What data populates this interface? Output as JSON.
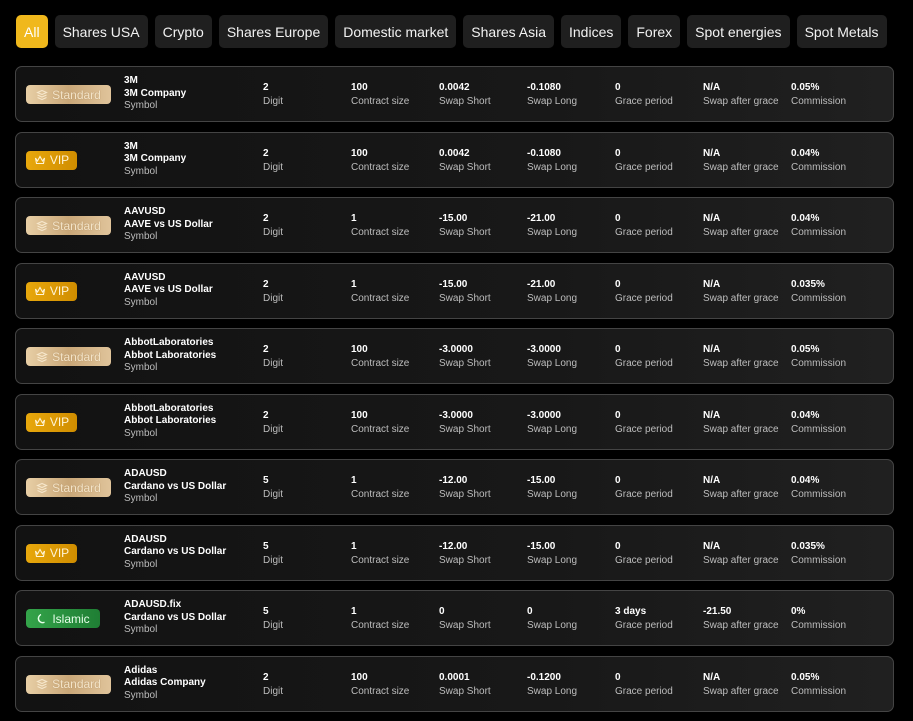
{
  "tabs": [
    "All",
    "Shares USA",
    "Crypto",
    "Shares Europe",
    "Domestic market",
    "Shares Asia",
    "Indices",
    "Forex",
    "Spot energies",
    "Spot Metals"
  ],
  "active_tab": "All",
  "labels": {
    "symbol": "Symbol",
    "digit": "Digit",
    "contract_size": "Contract size",
    "swap_short": "Swap Short",
    "swap_long": "Swap Long",
    "grace_period": "Grace period",
    "swap_after_grace": "Swap after grace",
    "commission": "Commission"
  },
  "colors": {
    "active_tab": "#f0b81c",
    "standard": "#d9bc8c",
    "vip": "#e09a05",
    "islamic": "#2a9140"
  },
  "rows": [
    {
      "account": "Standard",
      "icon": "layers-icon",
      "symbol": "3M",
      "name": "3M Company",
      "digit": "2",
      "contract_size": "100",
      "swap_short": "0.0042",
      "swap_long": "-0.1080",
      "grace_period": "0",
      "swap_after_grace": "N/A",
      "commission": "0.05%"
    },
    {
      "account": "VIP",
      "icon": "crown-icon",
      "symbol": "3M",
      "name": "3M Company",
      "digit": "2",
      "contract_size": "100",
      "swap_short": "0.0042",
      "swap_long": "-0.1080",
      "grace_period": "0",
      "swap_after_grace": "N/A",
      "commission": "0.04%"
    },
    {
      "account": "Standard",
      "icon": "layers-icon",
      "symbol": "AAVUSD",
      "name": "AAVE vs US Dollar",
      "digit": "2",
      "contract_size": "1",
      "swap_short": "-15.00",
      "swap_long": "-21.00",
      "grace_period": "0",
      "swap_after_grace": "N/A",
      "commission": "0.04%"
    },
    {
      "account": "VIP",
      "icon": "crown-icon",
      "symbol": "AAVUSD",
      "name": "AAVE vs US Dollar",
      "digit": "2",
      "contract_size": "1",
      "swap_short": "-15.00",
      "swap_long": "-21.00",
      "grace_period": "0",
      "swap_after_grace": "N/A",
      "commission": "0.035%"
    },
    {
      "account": "Standard",
      "icon": "layers-icon",
      "symbol": "AbbotLaboratories",
      "name": "Abbot Laboratories",
      "digit": "2",
      "contract_size": "100",
      "swap_short": "-3.0000",
      "swap_long": "-3.0000",
      "grace_period": "0",
      "swap_after_grace": "N/A",
      "commission": "0.05%"
    },
    {
      "account": "VIP",
      "icon": "crown-icon",
      "symbol": "AbbotLaboratories",
      "name": "Abbot Laboratories",
      "digit": "2",
      "contract_size": "100",
      "swap_short": "-3.0000",
      "swap_long": "-3.0000",
      "grace_period": "0",
      "swap_after_grace": "N/A",
      "commission": "0.04%"
    },
    {
      "account": "Standard",
      "icon": "layers-icon",
      "symbol": "ADAUSD",
      "name": "Cardano vs US Dollar",
      "digit": "5",
      "contract_size": "1",
      "swap_short": "-12.00",
      "swap_long": "-15.00",
      "grace_period": "0",
      "swap_after_grace": "N/A",
      "commission": "0.04%"
    },
    {
      "account": "VIP",
      "icon": "crown-icon",
      "symbol": "ADAUSD",
      "name": "Cardano vs US Dollar",
      "digit": "5",
      "contract_size": "1",
      "swap_short": "-12.00",
      "swap_long": "-15.00",
      "grace_period": "0",
      "swap_after_grace": "N/A",
      "commission": "0.035%"
    },
    {
      "account": "Islamic",
      "icon": "crescent-moon-icon",
      "symbol": "ADAUSD.fix",
      "name": "Cardano vs US Dollar",
      "digit": "5",
      "contract_size": "1",
      "swap_short": "0",
      "swap_long": "0",
      "grace_period": "3 days",
      "swap_after_grace": "-21.50",
      "commission": "0%"
    },
    {
      "account": "Standard",
      "icon": "layers-icon",
      "symbol": "Adidas",
      "name": "Adidas Company",
      "digit": "2",
      "contract_size": "100",
      "swap_short": "0.0001",
      "swap_long": "-0.1200",
      "grace_period": "0",
      "swap_after_grace": "N/A",
      "commission": "0.05%"
    }
  ]
}
